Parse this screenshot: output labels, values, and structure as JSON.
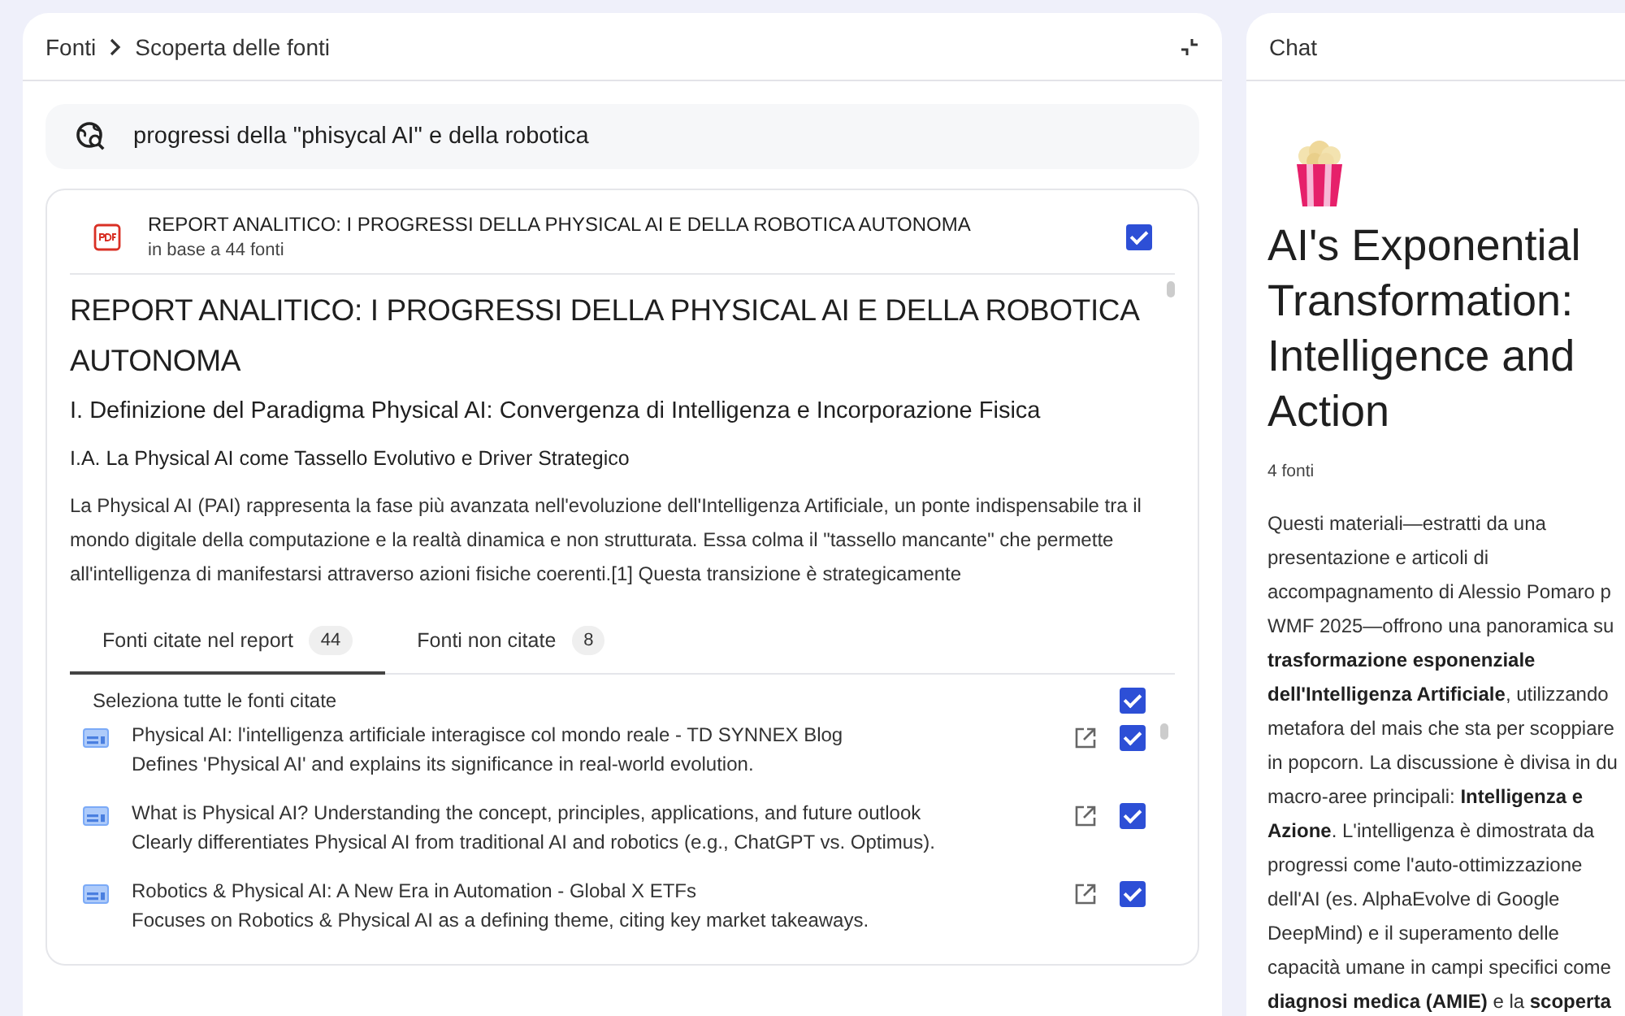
{
  "sources_panel": {
    "breadcrumb": [
      "Fonti",
      "Scoperta delle fonti"
    ],
    "query": "progressi della \"phisycal AI\" e della robotica",
    "report": {
      "title": "REPORT ANALITICO: I PROGRESSI DELLA PHYSICAL AI E DELLA ROBOTICA AUTONOMA",
      "subtitle": "in base a 44 fonti",
      "checked": true,
      "heading": "REPORT ANALITICO: I PROGRESSI DELLA PHYSICAL AI E DELLA ROBOTICA AUTONOMA",
      "section": "I. Definizione del Paradigma Physical AI: Convergenza di Intelligenza e Incorporazione Fisica",
      "subsection": "I.A. La Physical AI come Tassello Evolutivo e Driver Strategico",
      "paragraph": "La Physical AI (PAI) rappresenta la fase più avanzata nell'evoluzione dell'Intelligenza Artificiale, un ponte indispensabile tra il mondo digitale della computazione e la realtà dinamica e non strutturata. Essa colma il \"tassello mancante\" che permette all'intelligenza di manifestarsi attraverso azioni fisiche coerenti.[1] Questa transizione è strategicamente"
    },
    "tabs": [
      {
        "label": "Fonti citate nel report",
        "count": "44",
        "selected": true
      },
      {
        "label": "Fonti non citate",
        "count": "8",
        "selected": false
      }
    ],
    "select_all": {
      "label": "Seleziona tutte le fonti citate",
      "checked": true
    },
    "sources": [
      {
        "title": "Physical AI: l'intelligenza artificiale interagisce col mondo reale - TD SYNNEX Blog",
        "description": "Defines 'Physical AI' and explains its significance in real-world evolution.",
        "checked": true
      },
      {
        "title": "What is Physical AI? Understanding the concept, principles, applications, and future outlook",
        "description": "Clearly differentiates Physical AI from traditional AI and robotics (e.g., ChatGPT vs. Optimus).",
        "checked": true
      },
      {
        "title": "Robotics & Physical AI: A New Era in Automation - Global X ETFs",
        "description": "Focuses on Robotics & Physical AI as a defining theme, citing key market takeaways.",
        "checked": true
      }
    ]
  },
  "chat_panel": {
    "title": "Chat",
    "heading": "AI's Exponential Transformation: Intelligence and Action",
    "source_count": "4 fonti",
    "summary_lines": [
      "Questi materiali—estratti da una",
      "presentazione e articoli di",
      "accompagnamento di Alessio Pomaro p",
      "WMF 2025—offrono una panoramica su",
      "**trasformazione esponenziale**",
      "**dell'Intelligenza Artificiale**, utilizzando",
      "metafora del mais che sta per scoppiare",
      "in popcorn. La discussione è divisa in du",
      "macro-aree principali: **Intelligenza e**",
      "**Azione**. L'intelligenza è dimostrata da",
      "progressi come l'auto-ottimizzazione",
      "dell'AI (es. AlphaEvolve di Google",
      "DeepMind) e il superamento delle",
      "capacità umane in campi specifici come",
      "**diagnosi medica (AMIE)** e la **scoperta**"
    ]
  }
}
